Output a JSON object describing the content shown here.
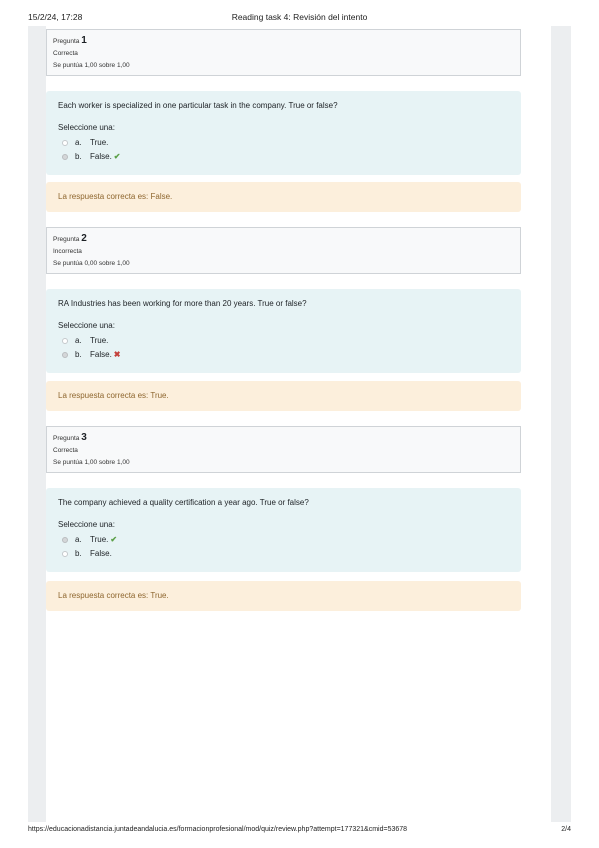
{
  "header": {
    "date": "15/2/24, 17:28",
    "title": "Reading task 4: Revisión del intento"
  },
  "questions": [
    {
      "label": "Pregunta",
      "number": "1",
      "status": "Correcta",
      "score": "Se puntúa 1,00 sobre 1,00",
      "text": "Each worker is specialized in one particular task in the company. True or false?",
      "prompt": "Seleccione una:",
      "options": [
        {
          "letter": "a.",
          "text": "True.",
          "selected": false,
          "mark": ""
        },
        {
          "letter": "b.",
          "text": "False.",
          "selected": true,
          "mark": "check-icon"
        }
      ],
      "feedback": "La respuesta correcta es: False."
    },
    {
      "label": "Pregunta",
      "number": "2",
      "status": "Incorrecta",
      "score": "Se puntúa 0,00 sobre 1,00",
      "text": "RA Industries has been working for more than 20 years. True or false?",
      "prompt": "Seleccione una:",
      "options": [
        {
          "letter": "a.",
          "text": "True.",
          "selected": false,
          "mark": ""
        },
        {
          "letter": "b.",
          "text": "False.",
          "selected": true,
          "mark": "cross-icon"
        }
      ],
      "feedback": "La respuesta correcta es: True."
    },
    {
      "label": "Pregunta",
      "number": "3",
      "status": "Correcta",
      "score": "Se puntúa 1,00 sobre 1,00",
      "text": "The company achieved a quality certification a year ago. True or false?",
      "prompt": "Seleccione una:",
      "options": [
        {
          "letter": "a.",
          "text": "True.",
          "selected": true,
          "mark": "check-icon"
        },
        {
          "letter": "b.",
          "text": "False.",
          "selected": false,
          "mark": ""
        }
      ],
      "feedback": "La respuesta correcta es: True."
    }
  ],
  "footer": {
    "url": "https://educacionadistancia.juntadeandalucia.es/formacionprofesional/mod/quiz/review.php?attempt=177321&cmid=53678",
    "page": "2/4"
  },
  "colors": {
    "question_bg": "#e7f3f5",
    "feedback_bg": "#fcefdc",
    "feedback_text": "#8e662e",
    "correct": "#5a9f46",
    "incorrect": "#c4403b"
  }
}
